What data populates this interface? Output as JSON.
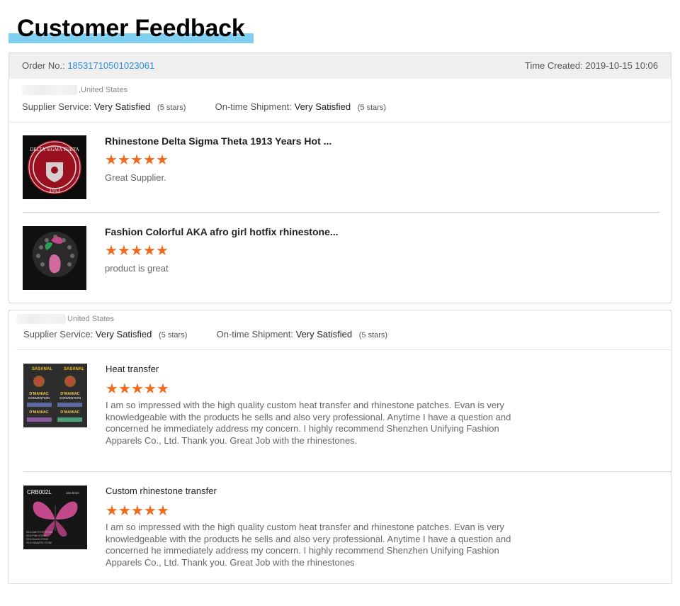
{
  "page": {
    "title": "Customer Feedback"
  },
  "order": {
    "label": "Order No.:",
    "number": "18531710501023061",
    "time_label": "Time Created: 2019-10-15 10:06"
  },
  "feedbacks": [
    {
      "country": ",United States",
      "supplier_label": "Supplier Service:",
      "supplier_value": "Very Satisfied",
      "supplier_stars": "(5 stars)",
      "shipment_label": "On-time Shipment:",
      "shipment_value": "Very Satisfied",
      "shipment_stars": "(5 stars)",
      "items": [
        {
          "title": "Rhinestone Delta Sigma Theta 1913 Years Hot ...",
          "rating": 5,
          "review": "Great Supplier."
        },
        {
          "title": "Fashion Colorful AKA afro girl hotfix rhinestone...",
          "rating": 5,
          "review": "product is great"
        }
      ]
    },
    {
      "country": "United States",
      "supplier_label": "Supplier Service:",
      "supplier_value": "Very Satisfied",
      "supplier_stars": "(5 stars)",
      "shipment_label": "On-time Shipment:",
      "shipment_value": "Very Satisfied",
      "shipment_stars": "(5 stars)",
      "items": [
        {
          "title": "Heat transfer",
          "rating": 5,
          "review": "I am so impressed with the high quality custom heat transfer and rhinestone patches. Evan is very knowledgeable with the products he sells and also very professional. Anytime I have a question and concerned he immediately address my concern. I highly recommend Shenzhen Unifying Fashion Apparels Co., Ltd.  Thank you. Great Job with the rhinestones."
        },
        {
          "title": "Custom rhinestone transfer",
          "rating": 5,
          "review": "I am so impressed with the high quality custom heat transfer and rhinestone patches. Evan is very knowledgeable with the products he sells and also very professional. Anytime I have a question and concerned he immediately address my concern. I highly recommend Shenzhen Unifying Fashion Apparels Co., Ltd.  Thank you. Great Job with the rhinestones"
        }
      ]
    }
  ],
  "thumb_text": {
    "t1_top": "DELTA SIGMA THETA",
    "t1_year": "1913",
    "t3_brand": "SASANAL",
    "t3_line1": "D'MANIAC",
    "t3_line2": "CONVENTION",
    "t4_code": "CRB002L",
    "t4_size": "101.0mm",
    "t4_legend": [
      "SS10 AMETHYST STONE",
      "SS10 PINK STONE",
      "SS10 BLACK STONE",
      "SS10 HEMATITE STONE"
    ]
  },
  "colors": {
    "accent_blue": "#2f8cd8",
    "star": "#f06a1d",
    "title_bar": "#7fd0f0"
  },
  "icons": {
    "star": "star-icon"
  }
}
